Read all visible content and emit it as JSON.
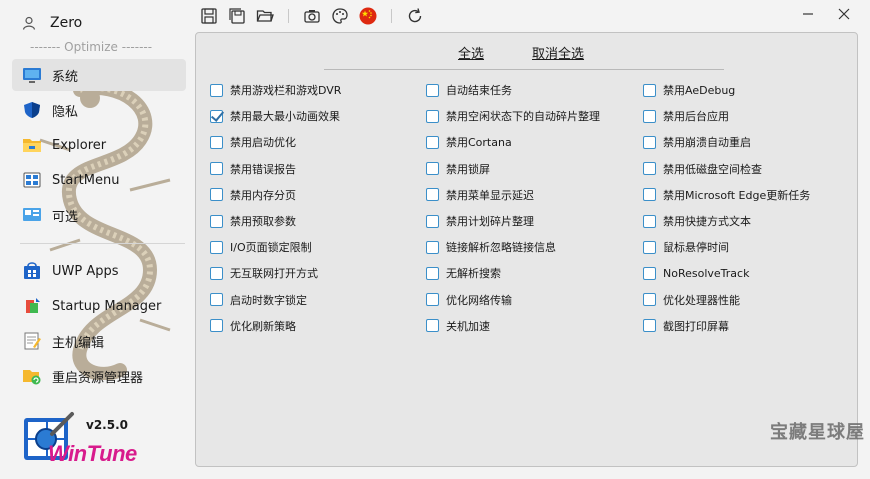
{
  "user": {
    "name": "Zero",
    "icon": "user-icon"
  },
  "sidebar": {
    "section_label": "------- Optimize -------",
    "items": [
      {
        "label": "系统",
        "icon": "monitor-icon",
        "active": true
      },
      {
        "label": "隐私",
        "icon": "shield-icon",
        "active": false
      },
      {
        "label": "Explorer",
        "icon": "folder-icon",
        "active": false
      },
      {
        "label": "StartMenu",
        "icon": "start-menu-icon",
        "active": false
      },
      {
        "label": "可选",
        "icon": "optional-icon",
        "active": false
      },
      {
        "label": "UWP Apps",
        "icon": "uwp-apps-icon",
        "active": false
      },
      {
        "label": "Startup Manager",
        "icon": "startup-manager-icon",
        "active": false
      },
      {
        "label": "主机编辑",
        "icon": "hosts-edit-icon",
        "active": false
      },
      {
        "label": "重启资源管理器",
        "icon": "restart-explorer-icon",
        "active": false
      }
    ]
  },
  "app": {
    "version": "v2.5.0",
    "logo_text": "WinTune"
  },
  "toolbar": {
    "icons": [
      "save-icon",
      "save-all-icon",
      "open-folder-icon",
      "camera-icon",
      "palette-icon",
      "china-flag-icon",
      "refresh-icon"
    ]
  },
  "window": {
    "minimize": "minimize-icon",
    "close": "close-icon"
  },
  "selection": {
    "select_all": "全选",
    "deselect_all": "取消全选"
  },
  "options": {
    "col1": [
      {
        "label": "禁用游戏栏和游戏DVR",
        "checked": false
      },
      {
        "label": "禁用最大最小动画效果",
        "checked": true
      },
      {
        "label": "禁用启动优化",
        "checked": false
      },
      {
        "label": "禁用错误报告",
        "checked": false
      },
      {
        "label": "禁用内存分页",
        "checked": false
      },
      {
        "label": "禁用预取参数",
        "checked": false
      },
      {
        "label": "I/O页面锁定限制",
        "checked": false
      },
      {
        "label": "无互联网打开方式",
        "checked": false
      },
      {
        "label": "启动时数字锁定",
        "checked": false
      },
      {
        "label": "优化刷新策略",
        "checked": false
      }
    ],
    "col2": [
      {
        "label": "自动结束任务",
        "checked": false
      },
      {
        "label": "禁用空闲状态下的自动碎片整理",
        "checked": false
      },
      {
        "label": "禁用Cortana",
        "checked": false
      },
      {
        "label": "禁用锁屏",
        "checked": false
      },
      {
        "label": "禁用菜单显示延迟",
        "checked": false
      },
      {
        "label": "禁用计划碎片整理",
        "checked": false
      },
      {
        "label": "链接解析忽略链接信息",
        "checked": false
      },
      {
        "label": "无解析搜索",
        "checked": false
      },
      {
        "label": "优化网络传输",
        "checked": false
      },
      {
        "label": "关机加速",
        "checked": false
      }
    ],
    "col3": [
      {
        "label": "禁用AeDebug",
        "checked": false
      },
      {
        "label": "禁用后台应用",
        "checked": false
      },
      {
        "label": "禁用崩溃自动重启",
        "checked": false
      },
      {
        "label": "禁用低磁盘空间检查",
        "checked": false
      },
      {
        "label": "禁用Microsoft Edge更新任务",
        "checked": false
      },
      {
        "label": "禁用快捷方式文本",
        "checked": false
      },
      {
        "label": "鼠标悬停时间",
        "checked": false
      },
      {
        "label": "NoResolveTrack",
        "checked": false
      },
      {
        "label": "优化处理器性能",
        "checked": false
      },
      {
        "label": "截图打印屏幕",
        "checked": false
      }
    ]
  },
  "watermark": "宝藏星球屋",
  "colors": {
    "checkbox_border": "#3b8fc9",
    "active_nav_bg": "#e3e3e3",
    "logo": "#d81b8c"
  }
}
